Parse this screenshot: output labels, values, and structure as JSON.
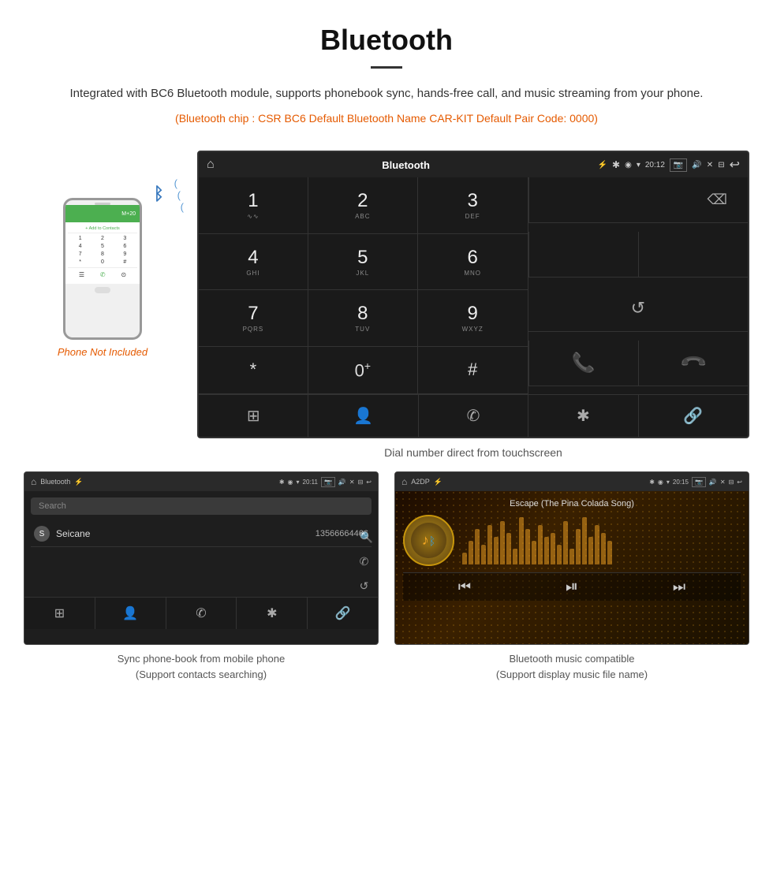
{
  "header": {
    "title": "Bluetooth",
    "description": "Integrated with BC6 Bluetooth module, supports phonebook sync, hands-free call, and music streaming from your phone.",
    "specs": "(Bluetooth chip : CSR BC6    Default Bluetooth Name CAR-KIT    Default Pair Code: 0000)"
  },
  "phone": {
    "not_included_label": "Phone Not Included",
    "add_contacts": "+ Add to Contacts",
    "number_display": "M+20",
    "dialpad_numbers": [
      "1",
      "2",
      "3",
      "4",
      "5",
      "6",
      "7",
      "8",
      "9",
      "*",
      "0",
      "#"
    ],
    "bottom_icons": [
      "☰",
      "✆",
      "●"
    ]
  },
  "main_screen": {
    "statusbar": {
      "app_title": "Bluetooth",
      "time": "20:12",
      "home_icon": "⌂",
      "usb_icon": "⚡"
    },
    "dialpad": {
      "keys": [
        {
          "num": "1",
          "sub": ""
        },
        {
          "num": "2",
          "sub": "ABC"
        },
        {
          "num": "3",
          "sub": "DEF"
        },
        {
          "num": "4",
          "sub": "GHI"
        },
        {
          "num": "5",
          "sub": "JKL"
        },
        {
          "num": "6",
          "sub": "MNO"
        },
        {
          "num": "7",
          "sub": "PQRS"
        },
        {
          "num": "8",
          "sub": "TUV"
        },
        {
          "num": "9",
          "sub": "WXYZ"
        },
        {
          "num": "*",
          "sub": ""
        },
        {
          "num": "0",
          "sub": "+"
        },
        {
          "num": "#",
          "sub": ""
        }
      ]
    },
    "caption": "Dial number direct from touchscreen",
    "func_bar": {
      "items": [
        "⊞",
        "👤",
        "✆",
        "✱",
        "🔗"
      ]
    }
  },
  "phonebook_screen": {
    "statusbar": {
      "app_title": "Bluetooth",
      "time": "20:11"
    },
    "search_placeholder": "Search",
    "contacts": [
      {
        "initial": "S",
        "name": "Seicane",
        "number": "13566664466"
      }
    ],
    "func_bar": [
      "⊞",
      "👤",
      "✆",
      "✱",
      "🔗"
    ]
  },
  "music_screen": {
    "statusbar": {
      "app_title": "A2DP",
      "time": "20:15"
    },
    "song_title": "Escape (The Pina Colada Song)",
    "controls": [
      "⏮",
      "⏯",
      "⏭"
    ]
  },
  "captions": {
    "phonebook": "Sync phone-book from mobile phone\n(Support contacts searching)",
    "music": "Bluetooth music compatible\n(Support display music file name)"
  }
}
